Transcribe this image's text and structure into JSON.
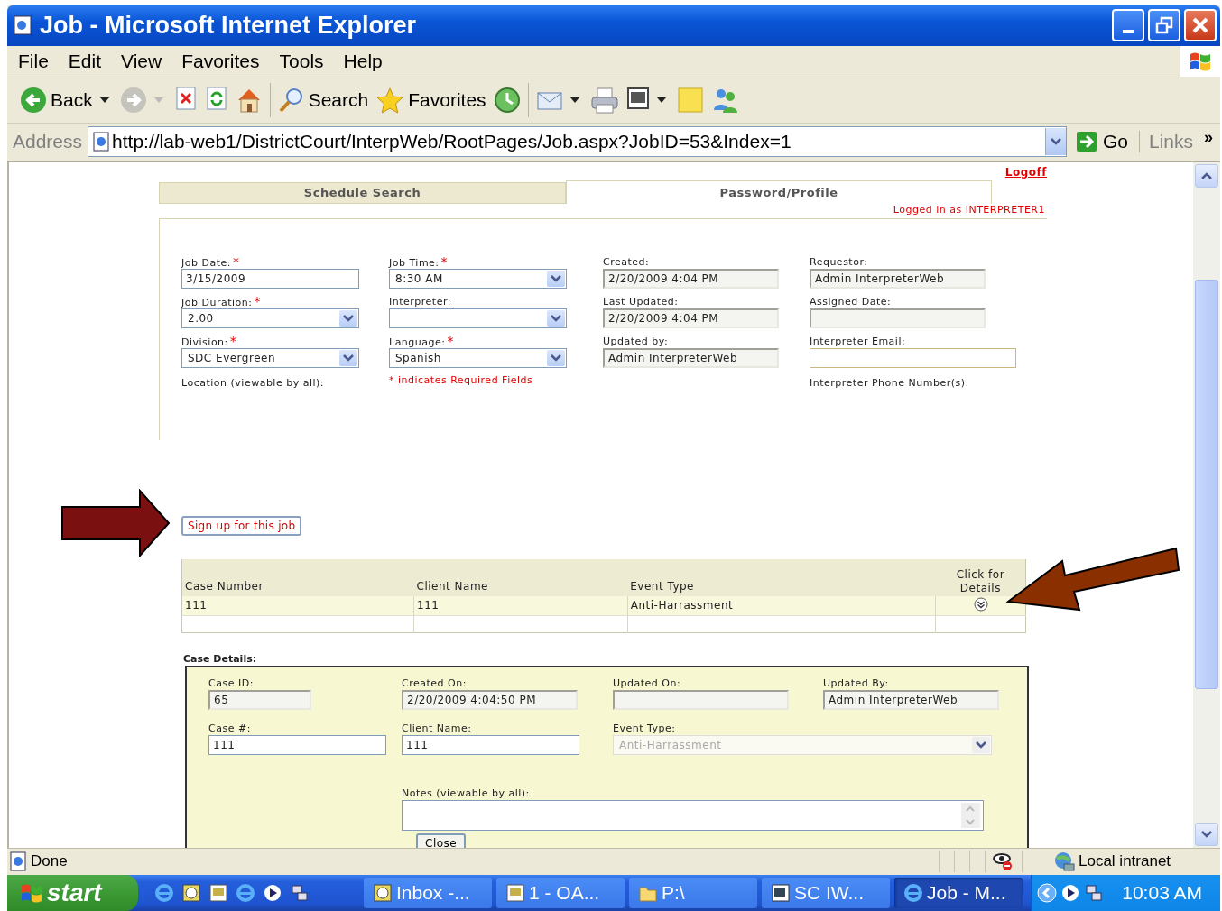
{
  "window": {
    "title": "Job - Microsoft Internet Explorer"
  },
  "menu": [
    "File",
    "Edit",
    "View",
    "Favorites",
    "Tools",
    "Help"
  ],
  "toolbar": [
    {
      "kind": "back",
      "label": "Back",
      "dropdown": true
    },
    {
      "kind": "forward",
      "dropdown": true
    },
    {
      "kind": "stop",
      "dropdown": false
    },
    {
      "kind": "refresh",
      "dropdown": false
    },
    {
      "kind": "home",
      "dropdown": false
    },
    {
      "kind": "separator"
    },
    {
      "kind": "search",
      "label": "Search",
      "dropdown": false
    },
    {
      "kind": "favorites",
      "label": "Favorites",
      "dropdown": false
    },
    {
      "kind": "history",
      "dropdown": false
    },
    {
      "kind": "separator"
    },
    {
      "kind": "mail",
      "dropdown": true
    },
    {
      "kind": "print",
      "dropdown": false
    },
    {
      "kind": "word",
      "dropdown": true
    },
    {
      "kind": "note",
      "dropdown": false
    },
    {
      "kind": "messenger",
      "dropdown": false
    }
  ],
  "address": {
    "label": "Address",
    "url": "http://lab-web1/DistrictCourt/InterpWeb/RootPages/Job.aspx?JobID=53&Index=1",
    "go": "Go",
    "links": "Links",
    "chevron": "»"
  },
  "page": {
    "logoff": "Logoff",
    "tabs": [
      {
        "label": "Schedule Search",
        "selected": false
      },
      {
        "label": "Password/Profile",
        "selected": true
      }
    ],
    "logged_in": "Logged in as INTERPRETER1",
    "required_mark": "*",
    "job_columns": [
      [
        {
          "label": "Job Date:",
          "kind": "text",
          "required": true,
          "value": "3/15/2009"
        },
        {
          "label": "Job Duration:",
          "kind": "select",
          "required": true,
          "value": "2.00"
        },
        {
          "label": "Division:",
          "kind": "select",
          "required": true,
          "value": "SDC Evergreen"
        },
        {
          "label": "Location (viewable by all):",
          "kind": "label"
        }
      ],
      [
        {
          "label": "Job Time:",
          "kind": "select",
          "required": true,
          "value": "8:30 AM"
        },
        {
          "label": "Interpreter:",
          "kind": "select",
          "required": false
        },
        {
          "label": "Language:",
          "kind": "select",
          "required": true,
          "value": "Spanish"
        },
        {
          "label": "indicates Required Fields",
          "kind": "note"
        }
      ],
      [
        {
          "label": "Created:",
          "kind": "readonly",
          "required": false,
          "value": "2/20/2009 4:04 PM"
        },
        {
          "label": "Last Updated:",
          "kind": "readonly",
          "required": false,
          "value": "2/20/2009 4:04 PM"
        },
        {
          "label": "Updated by:",
          "kind": "readonly",
          "required": false,
          "value": "Admin InterpreterWeb"
        }
      ],
      [
        {
          "label": "Requestor:",
          "kind": "readonly",
          "required": false,
          "value": "Admin InterpreterWeb"
        },
        {
          "label": "Assigned Date:",
          "kind": "readonly",
          "required": false
        },
        {
          "label": "Interpreter Email:",
          "kind": "wide_text",
          "required": false
        },
        {
          "label": "Interpreter Phone Number(s):",
          "kind": "label"
        }
      ]
    ],
    "signup_button": "Sign up for this job",
    "cases": {
      "columns": [
        "Case Number",
        "Client Name",
        "Event Type",
        "Click for Details"
      ],
      "rows": [
        {
          "cells": [
            "111",
            "111",
            "Anti-Harrassment"
          ]
        }
      ]
    },
    "case_details": {
      "title": "Case Details:",
      "fields": [
        {
          "label": "Case ID:",
          "kind": "short_readonly",
          "value": "65"
        },
        {
          "label": "Created On:",
          "kind": "readonly",
          "value": "2/20/2009 4:04:50 PM"
        },
        {
          "label": "Updated On:",
          "kind": "readonly"
        },
        {
          "label": "Updated By:",
          "kind": "readonly",
          "value": "Admin InterpreterWeb"
        },
        {
          "label": "Case #:",
          "kind": "text",
          "value": "111"
        },
        {
          "label": "Client Name:",
          "kind": "text",
          "value": "111"
        },
        {
          "label": "Event Type:",
          "kind": "disabled_select",
          "value": "Anti-Harrassment"
        }
      ],
      "notes_label": "Notes (viewable by all):",
      "close": "Close"
    }
  },
  "status_bar": {
    "text": "Done",
    "zone": "Local intranet"
  },
  "taskbar": {
    "start": "start",
    "tasks": [
      {
        "kind": "mail",
        "label": "Inbox -...",
        "selected": false
      },
      {
        "kind": "doc",
        "label": "1 - OA...",
        "selected": false
      },
      {
        "kind": "folder",
        "label": "P:\\",
        "selected": false
      },
      {
        "kind": "word",
        "label": "SC IW...",
        "selected": false
      },
      {
        "kind": "ie",
        "label": "Job - M...",
        "selected": true
      }
    ],
    "clock": "10:03 AM"
  }
}
